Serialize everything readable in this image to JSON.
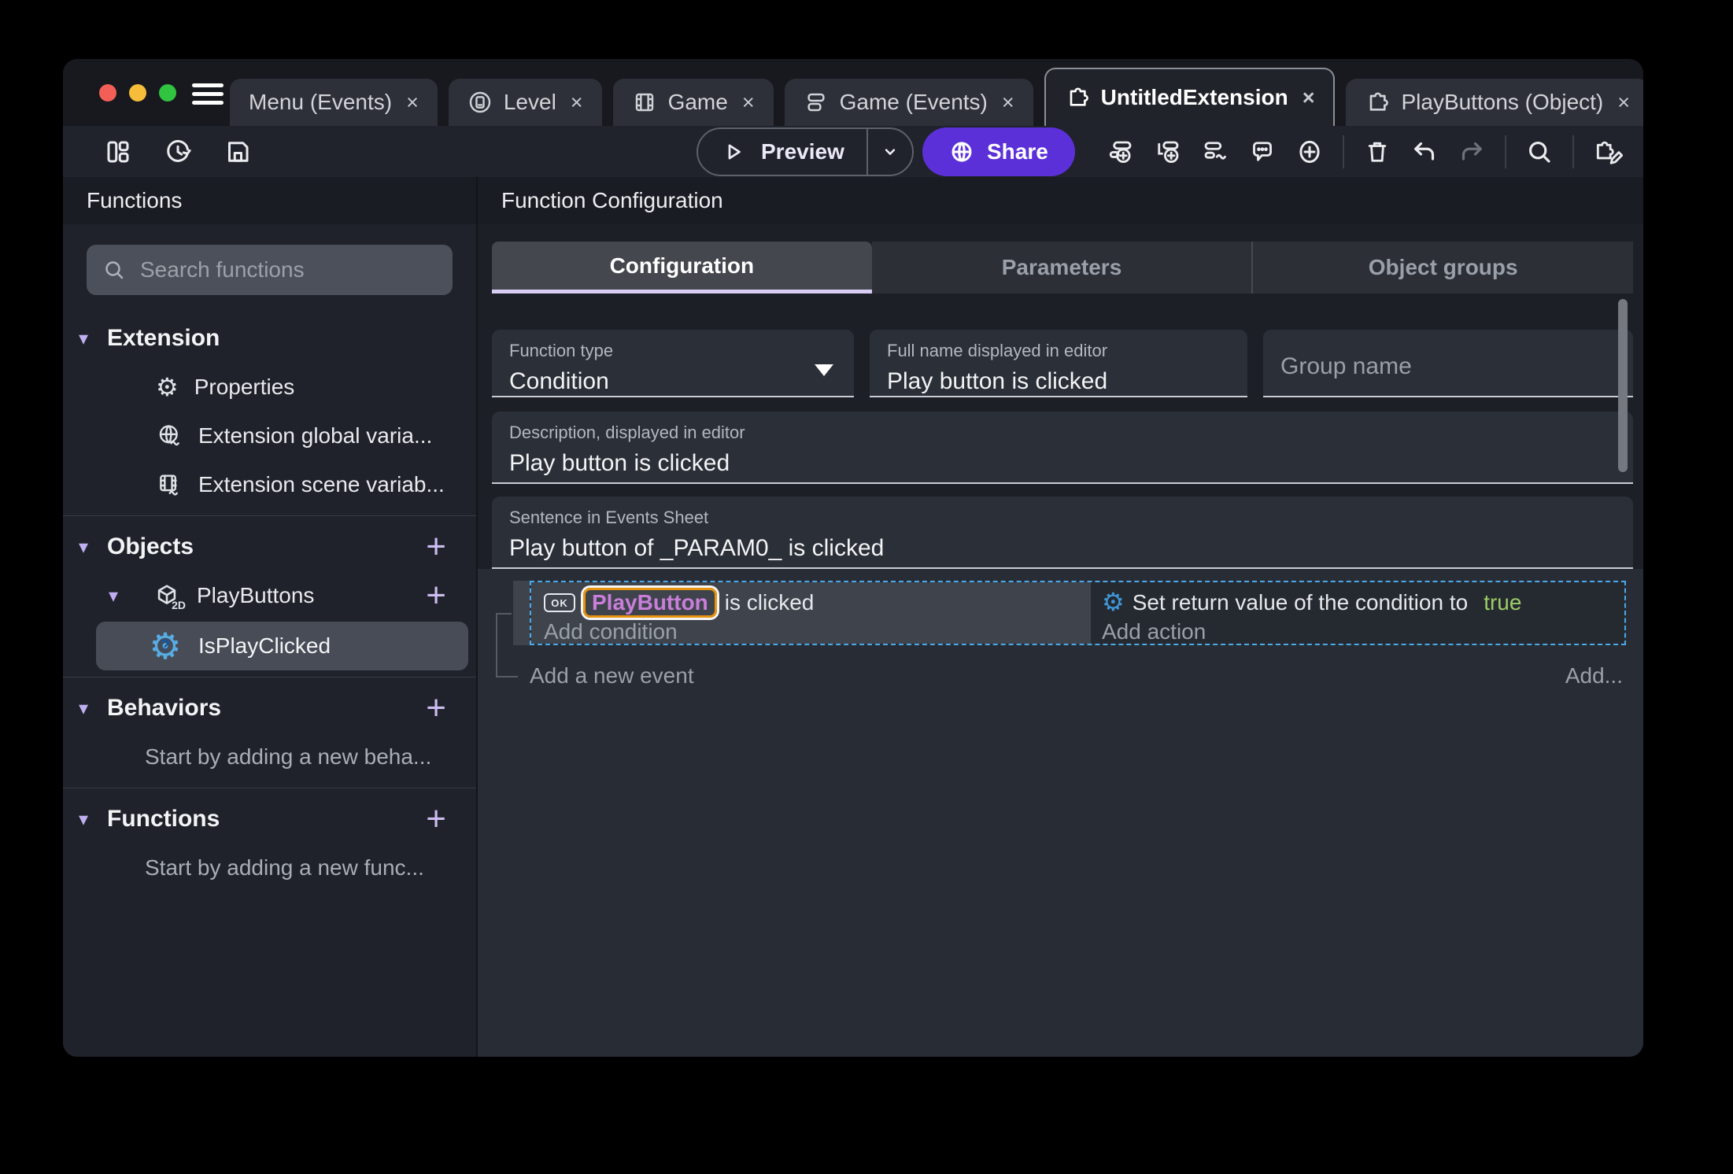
{
  "ui": {
    "close": "×",
    "cube_2d": "2D"
  },
  "tabs": [
    {
      "label": "Menu (Events)",
      "icon": "none"
    },
    {
      "label": "Level",
      "icon": "device-icon"
    },
    {
      "label": "Game",
      "icon": "film-icon"
    },
    {
      "label": "Game (Events)",
      "icon": "events-icon"
    },
    {
      "label": "UntitledExtension",
      "icon": "puzzle-icon",
      "active": true
    },
    {
      "label": "PlayButtons (Object)",
      "icon": "puzzle-icon"
    }
  ],
  "toolbar": {
    "preview_label": "Preview",
    "share_label": "Share",
    "left_icons": [
      "project-manager-icon",
      "history-icon",
      "save-icon"
    ],
    "right_icons": [
      "add-event-icon",
      "add-subevent-icon",
      "add-other-event-icon",
      "comment-icon",
      "circle-plus-icon",
      "trash-icon",
      "undo-icon",
      "redo-icon",
      "search-icon",
      "edit-extension-icon"
    ]
  },
  "sidebar": {
    "title": "Functions",
    "search_placeholder": "Search functions",
    "sections": [
      {
        "title": "Extension",
        "items": [
          {
            "label": "Properties",
            "icon": "gear-icon"
          },
          {
            "label": "Extension global varia...",
            "icon": "globe-variable-icon"
          },
          {
            "label": "Extension scene variab...",
            "icon": "scene-variable-icon"
          }
        ]
      },
      {
        "title": "Objects",
        "has_add": true,
        "items": [
          {
            "label": "PlayButtons",
            "icon": "cube-2d-icon",
            "has_add": true,
            "children": [
              {
                "label": "IsPlayClicked",
                "icon": "condition-function-icon",
                "selected": true
              }
            ]
          }
        ]
      },
      {
        "title": "Behaviors",
        "has_add": true,
        "hint": "Start by adding a new beha..."
      },
      {
        "title": "Functions",
        "has_add": true,
        "hint": "Start by adding a new func..."
      }
    ]
  },
  "main": {
    "title": "Function Configuration",
    "tabs": [
      {
        "label": "Configuration",
        "active": true
      },
      {
        "label": "Parameters"
      },
      {
        "label": "Object groups"
      }
    ],
    "fields": {
      "function_type": {
        "label": "Function type",
        "value": "Condition"
      },
      "full_name": {
        "label": "Full name displayed in editor",
        "value": "Play button is clicked"
      },
      "group_name": {
        "placeholder": "Group name"
      },
      "description": {
        "label": "Description, displayed in editor",
        "value": "Play button is clicked"
      },
      "sentence": {
        "label": "Sentence in Events Sheet",
        "value": "Play button of _PARAM0_ is clicked"
      }
    },
    "events": {
      "condition_object_icon_label": "OK",
      "condition_object": "PlayButton",
      "condition_text": "is clicked",
      "add_condition": "Add condition",
      "action_text": "Set return value of the condition to",
      "action_value": "true",
      "add_action": "Add action",
      "add_new_event": "Add a new event",
      "add_more": "Add..."
    }
  },
  "colors": {
    "accent_purple": "#5c30d9",
    "selection_border": "#4aa9e9",
    "object_highlight_border": "#e6930f",
    "object_text": "#c97fd9",
    "boolean_true": "#9ccc65"
  }
}
